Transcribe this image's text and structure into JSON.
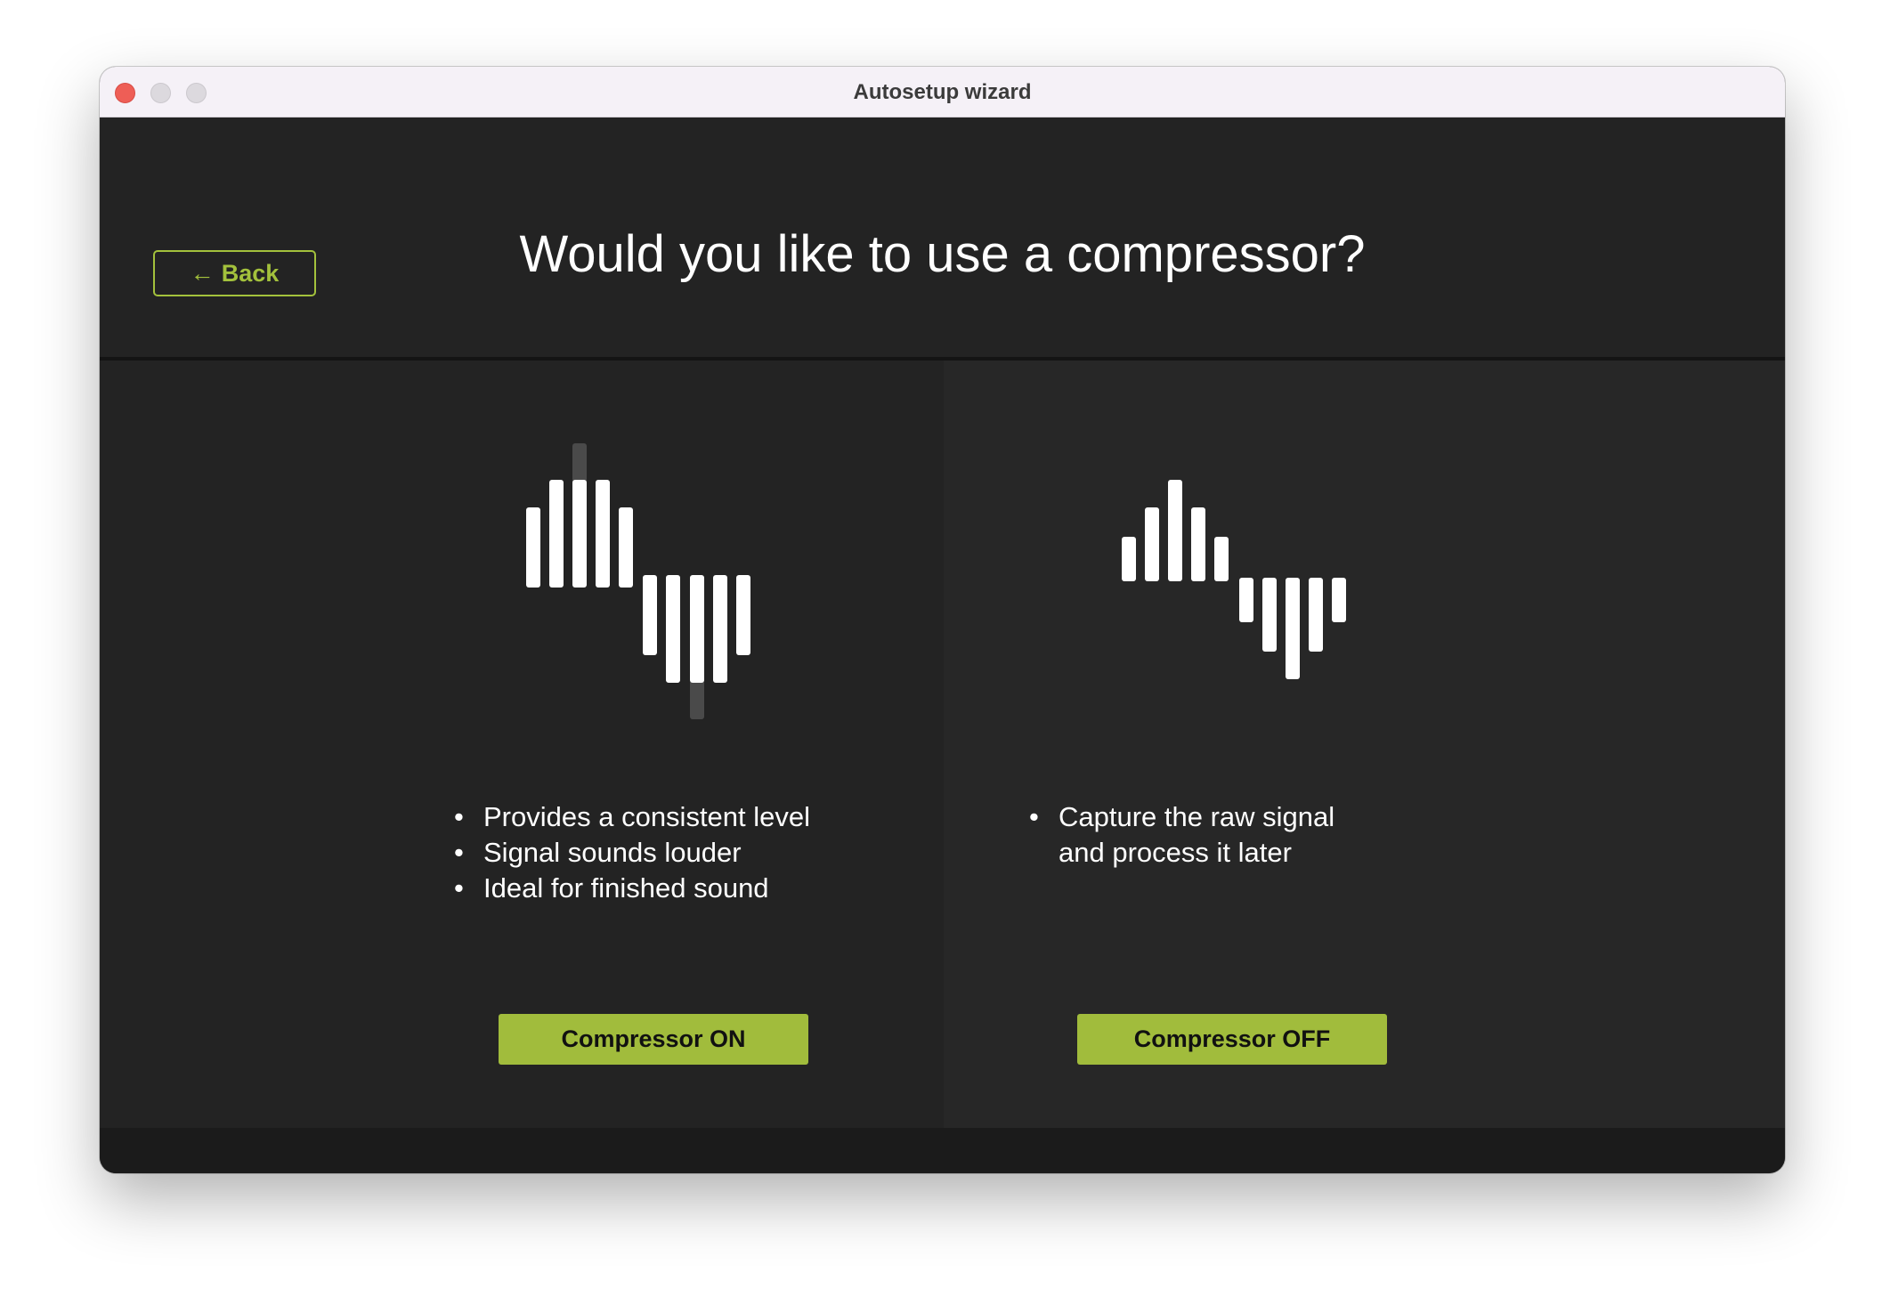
{
  "window": {
    "title": "Autosetup wizard"
  },
  "header": {
    "back_arrow": "←",
    "back_label": "Back",
    "question": "Would you like to use a compressor?"
  },
  "options": [
    {
      "features": [
        "Provides a consistent level",
        "Signal sounds louder",
        "Ideal for finished sound"
      ],
      "button_label": "Compressor ON",
      "icon": "compressed-waveform-icon"
    },
    {
      "features": [
        "Capture the raw signal\nand process it later"
      ],
      "button_label": "Compressor OFF",
      "icon": "raw-waveform-icon"
    }
  ],
  "colors": {
    "accent": "#a1bc3c",
    "background": "#232323",
    "text": "#ffffff"
  }
}
